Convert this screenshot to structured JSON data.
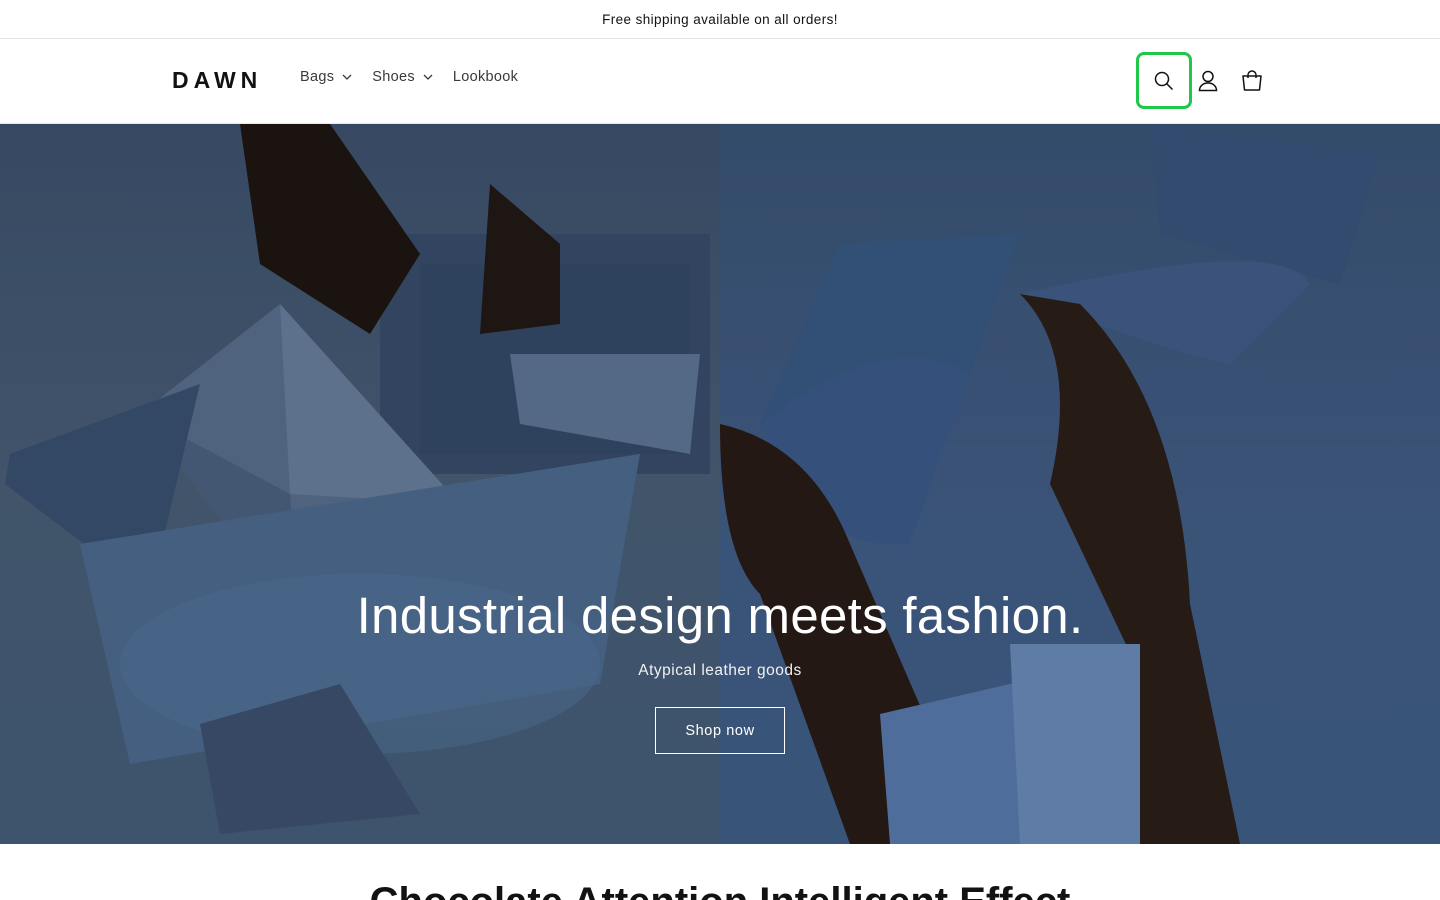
{
  "announcement": {
    "text": "Free shipping available on all orders!"
  },
  "header": {
    "logo": "DAWN",
    "nav": [
      {
        "label": "Bags",
        "has_dropdown": true
      },
      {
        "label": "Shoes",
        "has_dropdown": true
      },
      {
        "label": "Lookbook",
        "has_dropdown": false
      }
    ],
    "icons": [
      "search-icon",
      "account-icon",
      "cart-icon"
    ]
  },
  "hero": {
    "title": "Industrial design meets fashion.",
    "subtitle": "Atypical leather goods",
    "button_label": "Shop now"
  },
  "next_section": {
    "heading": "Chocolate Attention Intelligent Effect"
  },
  "colors": {
    "focus_ring": "#1fc84a",
    "text": "#121212",
    "hero_left_bg": "#4a6079",
    "hero_right_bg": "#43608a"
  }
}
